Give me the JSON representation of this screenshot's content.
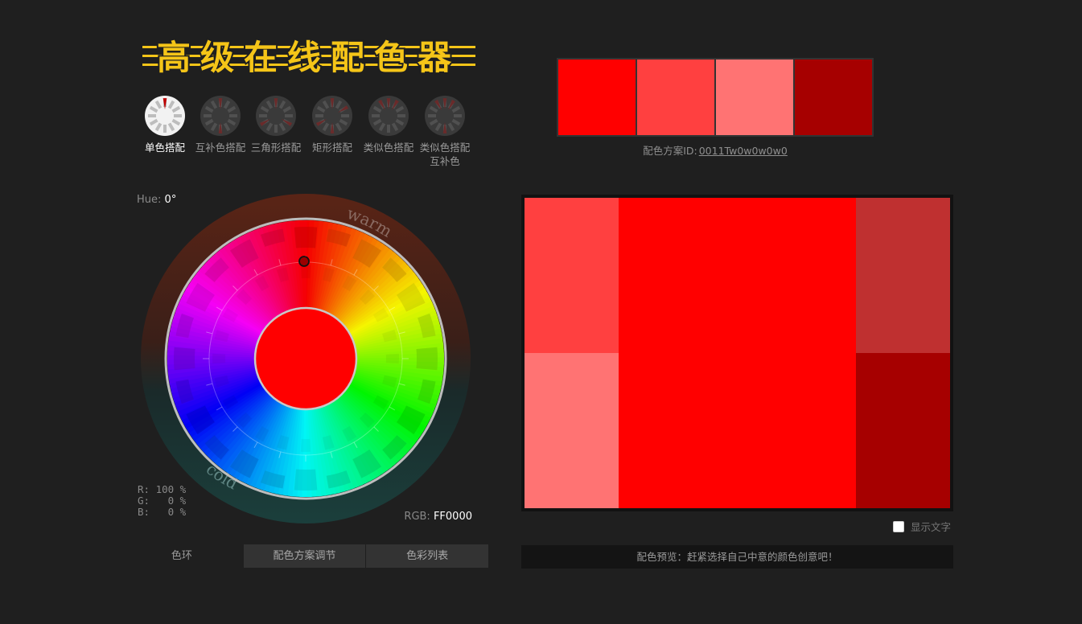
{
  "logo": {
    "title": "高级在线配色器",
    "accent": "#f5c518"
  },
  "schemes": [
    {
      "label": "单色搭配",
      "active": true
    },
    {
      "label": "互补色搭配",
      "active": false
    },
    {
      "label": "三角形搭配",
      "active": false
    },
    {
      "label": "矩形搭配",
      "active": false
    },
    {
      "label": "类似色搭配",
      "active": false
    },
    {
      "label": "类似色搭配互补色",
      "active": false
    }
  ],
  "wheel": {
    "hue_label": "Hue:",
    "hue_value": "0°",
    "warm_label": "warm",
    "cold_label": "cold",
    "center_color": "#FF0000",
    "r_line": "R: 100 %",
    "g_line": "G:   0 %",
    "b_line": "B:   0 %",
    "rgb_label": "RGB:",
    "rgb_value": "FF0000"
  },
  "tabs": [
    {
      "label": "色环",
      "active": true
    },
    {
      "label": "配色方案调节",
      "active": false
    },
    {
      "label": "色彩列表",
      "active": false
    }
  ],
  "palette": {
    "colors": [
      "#FF0000",
      "#FF4040",
      "#FF7373",
      "#A60000"
    ],
    "id_label": "配色方案ID:",
    "id_value": "0011Tw0w0w0w0"
  },
  "preview": {
    "colors": {
      "main": "#FF0000",
      "top_left": "#FF4040",
      "bottom_left": "#FF7373",
      "top_right": "#BF3030",
      "bottom_right": "#A60000"
    },
    "show_text_label": "显示文字",
    "show_text_checked": false,
    "footer": "配色预览：赶紧选择自己中意的颜色创意吧！"
  }
}
